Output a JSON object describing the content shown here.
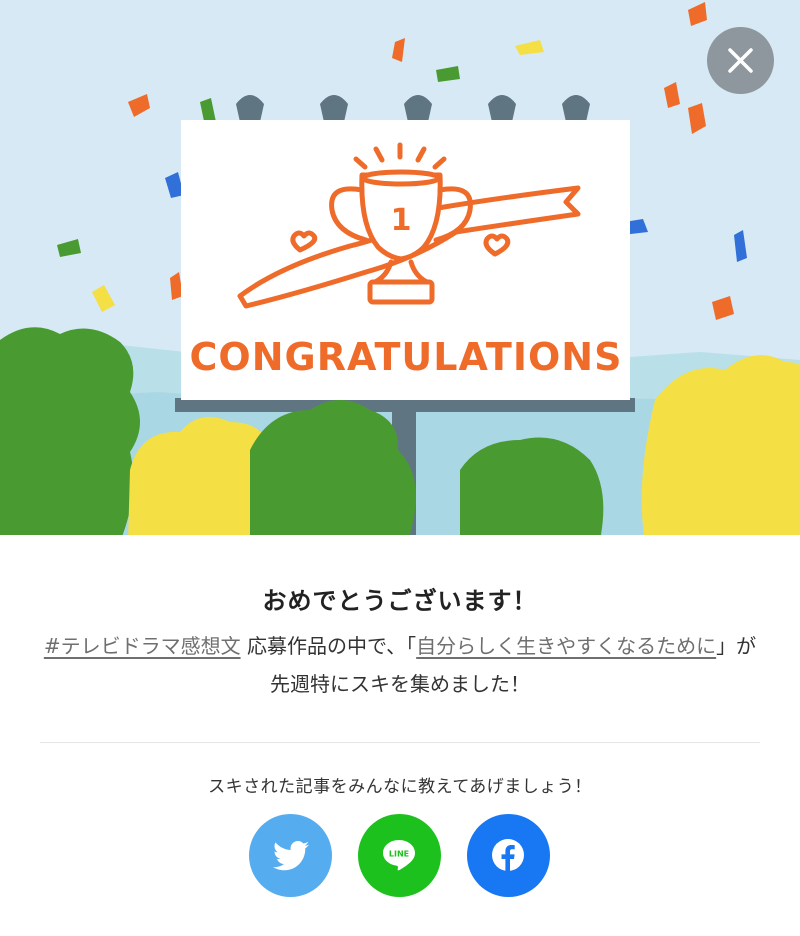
{
  "banner": {
    "icon": "trophy-congratulations-billboard",
    "billboard_text": "CONGRATULATIONS",
    "trophy_number": "1",
    "colors": {
      "sky": "#d6e9f5",
      "billboard": "#ffffff",
      "accent_orange": "#ef6b2a",
      "post": "#5f7582",
      "tree_green": "#4a9a32",
      "tree_yellow": "#f4df45"
    }
  },
  "close_button": {
    "icon": "close-icon",
    "color": "#8f979e"
  },
  "dialog": {
    "title": "おめでとうございます！",
    "hashtag_link": "#テレビドラマ感想文",
    "text_after_hashtag": " 応募作品の中で、「",
    "article_link": "自分らしく生きやすくなるために",
    "text_after_article": "」が先週特にスキを集めました！",
    "share_prompt": "スキされた記事をみんなに教えてあげましょう！"
  },
  "share_buttons": [
    {
      "name": "twitter",
      "icon": "twitter-bird-icon",
      "color": "#55acee"
    },
    {
      "name": "line",
      "icon": "line-icon",
      "label": "LINE",
      "color": "#1dc11d"
    },
    {
      "name": "facebook",
      "icon": "facebook-icon",
      "color": "#1877f2"
    }
  ]
}
